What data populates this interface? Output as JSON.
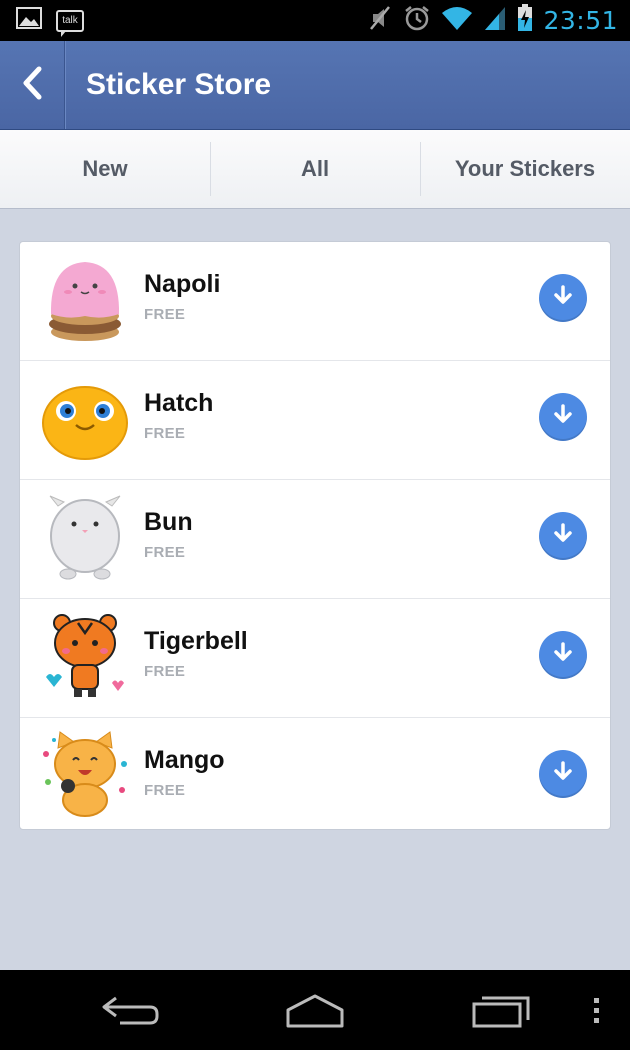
{
  "status_bar": {
    "time": "23:51",
    "talk_label": "talk",
    "icons": [
      "gallery-icon",
      "talk-icon",
      "mute-icon",
      "alarm-icon",
      "wifi-icon",
      "signal-icon",
      "battery-charging-icon"
    ]
  },
  "app_bar": {
    "title": "Sticker Store",
    "back_icon": "chevron-left-icon"
  },
  "tabs": [
    {
      "label": "New"
    },
    {
      "label": "All"
    },
    {
      "label": "Your Stickers"
    }
  ],
  "stickers": [
    {
      "name": "Napoli",
      "price": "FREE"
    },
    {
      "name": "Hatch",
      "price": "FREE"
    },
    {
      "name": "Bun",
      "price": "FREE"
    },
    {
      "name": "Tigerbell",
      "price": "FREE"
    },
    {
      "name": "Mango",
      "price": "FREE"
    }
  ],
  "nav_bar": {
    "icons": [
      "back-icon",
      "home-icon",
      "recent-apps-icon",
      "menu-icon"
    ]
  },
  "colors": {
    "accent": "#33b5e5",
    "app_bar": "#4f6cab",
    "download_button": "#4d8ae3"
  }
}
